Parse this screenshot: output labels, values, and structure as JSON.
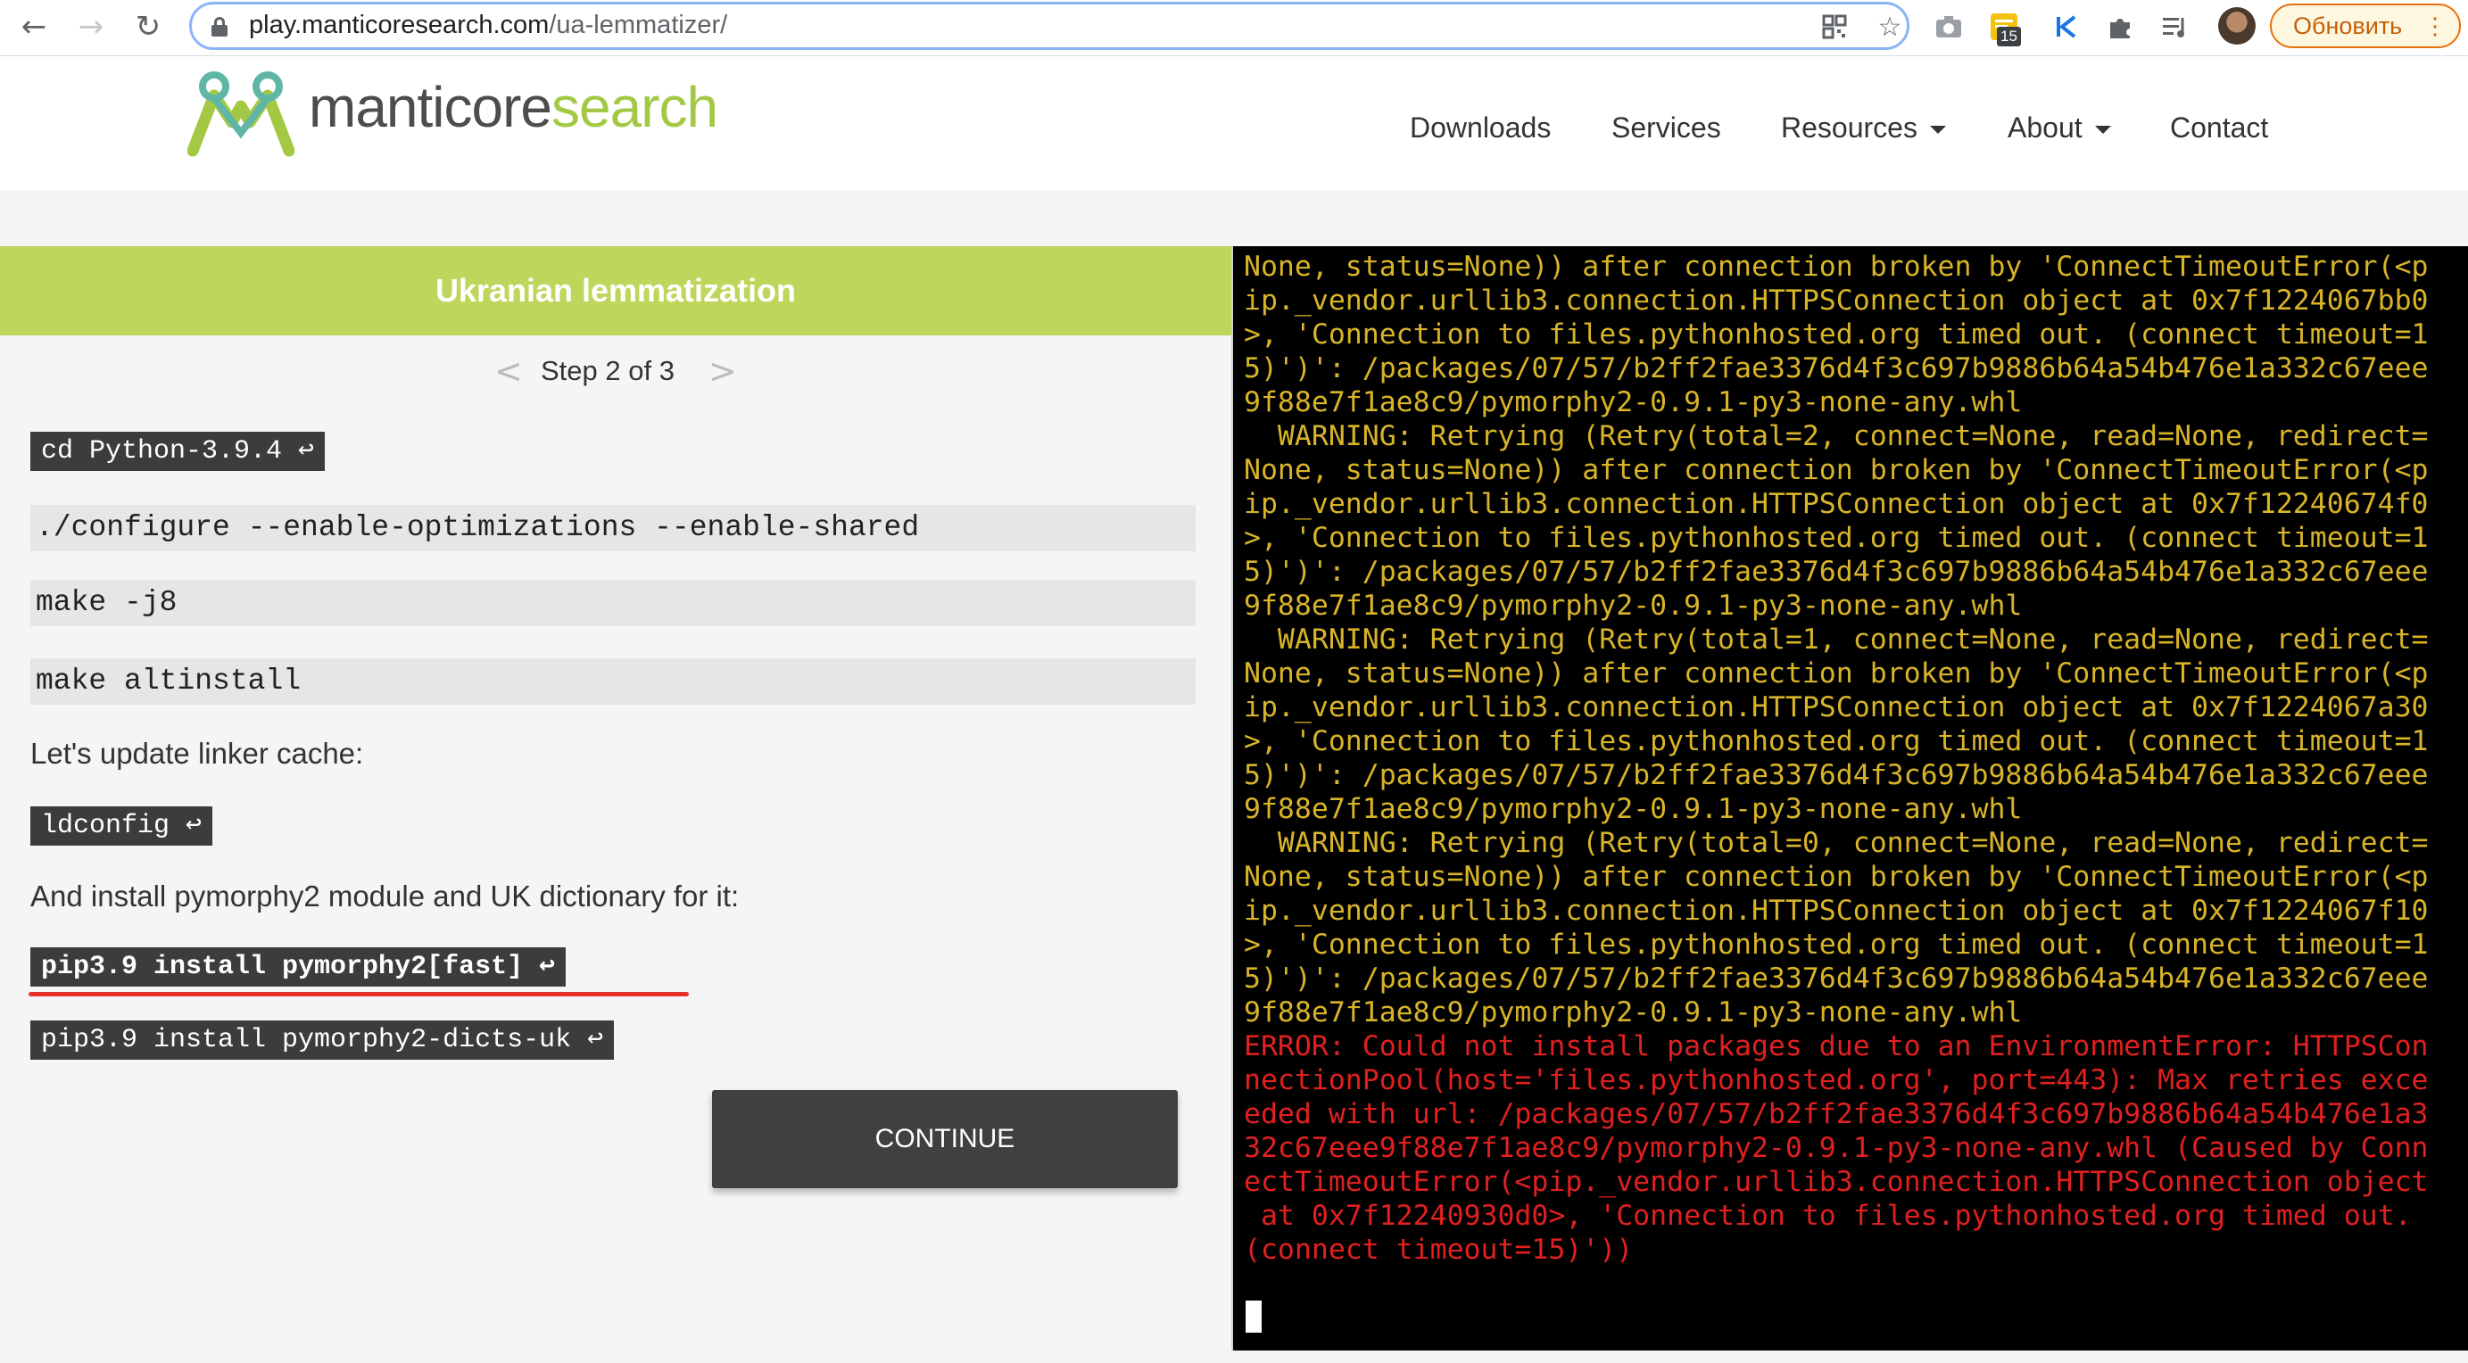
{
  "browser": {
    "url_host": "play.manticoresearch.com",
    "url_path": "/ua-lemmatizer/",
    "extension_badge": "15",
    "update_button_label": "Обновить"
  },
  "site": {
    "logo_part1": "manticore",
    "logo_part2": "search",
    "nav": {
      "downloads": "Downloads",
      "services": "Services",
      "resources": "Resources",
      "about": "About",
      "contact": "Contact"
    }
  },
  "panel": {
    "title": "Ukranian lemmatization",
    "step_prev": "<",
    "step_text": "Step 2 of 3",
    "step_next": ">",
    "cmd_cd": "cd Python-3.9.4 ↩",
    "cmd_configure": "./configure --enable-optimizations --enable-shared",
    "cmd_make": "make -j8",
    "cmd_altinstall": "make altinstall",
    "text_linker": "Let's update linker cache:",
    "cmd_ldconfig": "ldconfig ↩",
    "text_pymorphy": "And install pymorphy2 module and UK dictionary for it:",
    "cmd_pip_fast": "pip3.9 install pymorphy2[fast] ↩",
    "cmd_pip_dicts": "pip3.9 install pymorphy2-dicts-uk ↩",
    "continue_label": "CONTINUE"
  },
  "terminal": {
    "lines": [
      {
        "t": "None, status=None)) after connection broken by 'ConnectTimeoutError(<p",
        "k": "warn"
      },
      {
        "t": "ip._vendor.urllib3.connection.HTTPSConnection object at 0x7f1224067bb0",
        "k": "warn"
      },
      {
        "t": ">, 'Connection to files.pythonhosted.org timed out. (connect timeout=1",
        "k": "warn"
      },
      {
        "t": "5)')': /packages/07/57/b2ff2fae3376d4f3c697b9886b64a54b476e1a332c67eee",
        "k": "warn"
      },
      {
        "t": "9f88e7f1ae8c9/pymorphy2-0.9.1-py3-none-any.whl",
        "k": "warn"
      },
      {
        "t": "  WARNING: Retrying (Retry(total=2, connect=None, read=None, redirect=",
        "k": "warn"
      },
      {
        "t": "None, status=None)) after connection broken by 'ConnectTimeoutError(<p",
        "k": "warn"
      },
      {
        "t": "ip._vendor.urllib3.connection.HTTPSConnection object at 0x7f12240674f0",
        "k": "warn"
      },
      {
        "t": ">, 'Connection to files.pythonhosted.org timed out. (connect timeout=1",
        "k": "warn"
      },
      {
        "t": "5)')': /packages/07/57/b2ff2fae3376d4f3c697b9886b64a54b476e1a332c67eee",
        "k": "warn"
      },
      {
        "t": "9f88e7f1ae8c9/pymorphy2-0.9.1-py3-none-any.whl",
        "k": "warn"
      },
      {
        "t": "  WARNING: Retrying (Retry(total=1, connect=None, read=None, redirect=",
        "k": "warn"
      },
      {
        "t": "None, status=None)) after connection broken by 'ConnectTimeoutError(<p",
        "k": "warn"
      },
      {
        "t": "ip._vendor.urllib3.connection.HTTPSConnection object at 0x7f1224067a30",
        "k": "warn"
      },
      {
        "t": ">, 'Connection to files.pythonhosted.org timed out. (connect timeout=1",
        "k": "warn"
      },
      {
        "t": "5)')': /packages/07/57/b2ff2fae3376d4f3c697b9886b64a54b476e1a332c67eee",
        "k": "warn"
      },
      {
        "t": "9f88e7f1ae8c9/pymorphy2-0.9.1-py3-none-any.whl",
        "k": "warn"
      },
      {
        "t": "  WARNING: Retrying (Retry(total=0, connect=None, read=None, redirect=",
        "k": "warn"
      },
      {
        "t": "None, status=None)) after connection broken by 'ConnectTimeoutError(<p",
        "k": "warn"
      },
      {
        "t": "ip._vendor.urllib3.connection.HTTPSConnection object at 0x7f1224067f10",
        "k": "warn"
      },
      {
        "t": ">, 'Connection to files.pythonhosted.org timed out. (connect timeout=1",
        "k": "warn"
      },
      {
        "t": "5)')': /packages/07/57/b2ff2fae3376d4f3c697b9886b64a54b476e1a332c67eee",
        "k": "warn"
      },
      {
        "t": "9f88e7f1ae8c9/pymorphy2-0.9.1-py3-none-any.whl",
        "k": "warn"
      },
      {
        "t": "ERROR: Could not install packages due to an EnvironmentError: HTTPSCon",
        "k": "err"
      },
      {
        "t": "nectionPool(host='files.pythonhosted.org', port=443): Max retries exce",
        "k": "err"
      },
      {
        "t": "eded with url: /packages/07/57/b2ff2fae3376d4f3c697b9886b64a54b476e1a3",
        "k": "err"
      },
      {
        "t": "32c67eee9f88e7f1ae8c9/pymorphy2-0.9.1-py3-none-any.whl (Caused by Conn",
        "k": "err"
      },
      {
        "t": "ectTimeoutError(<pip._vendor.urllib3.connection.HTTPSConnection object",
        "k": "err"
      },
      {
        "t": " at 0x7f12240930d0>, 'Connection to files.pythonhosted.org timed out.",
        "k": "err"
      },
      {
        "t": "(connect timeout=15)'))",
        "k": "err"
      }
    ]
  },
  "colors": {
    "accent_green": "#bed65c",
    "terminal_warning": "#d8b428",
    "terminal_error": "#e02020",
    "update_orange": "#e8710a"
  },
  "icons": {
    "back": "arrow-left-icon",
    "forward": "arrow-right-icon",
    "reload": "reload-icon",
    "lock": "lock-icon",
    "star": "star-icon",
    "camera": "camera-icon",
    "puzzle": "puzzle-icon",
    "playlist": "media-icon",
    "kebab": "more-vert-icon"
  }
}
